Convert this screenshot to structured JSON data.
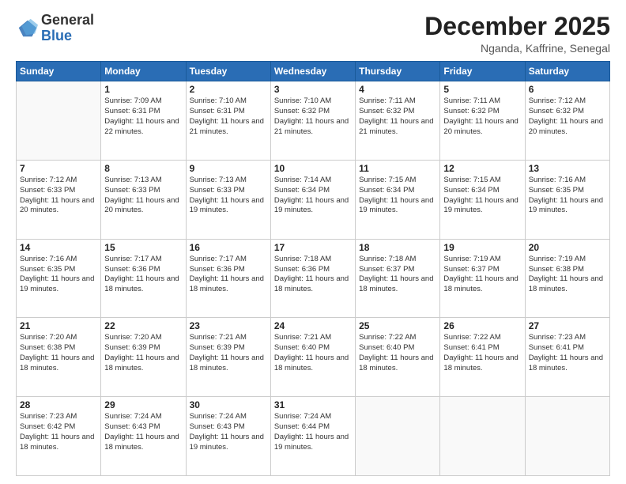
{
  "logo": {
    "general": "General",
    "blue": "Blue"
  },
  "header": {
    "month": "December 2025",
    "location": "Nganda, Kaffrine, Senegal"
  },
  "weekdays": [
    "Sunday",
    "Monday",
    "Tuesday",
    "Wednesday",
    "Thursday",
    "Friday",
    "Saturday"
  ],
  "weeks": [
    [
      {
        "day": "",
        "sunrise": "",
        "sunset": "",
        "daylight": ""
      },
      {
        "day": "1",
        "sunrise": "7:09 AM",
        "sunset": "6:31 PM",
        "daylight": "11 hours and 22 minutes."
      },
      {
        "day": "2",
        "sunrise": "7:10 AM",
        "sunset": "6:31 PM",
        "daylight": "11 hours and 21 minutes."
      },
      {
        "day": "3",
        "sunrise": "7:10 AM",
        "sunset": "6:32 PM",
        "daylight": "11 hours and 21 minutes."
      },
      {
        "day": "4",
        "sunrise": "7:11 AM",
        "sunset": "6:32 PM",
        "daylight": "11 hours and 21 minutes."
      },
      {
        "day": "5",
        "sunrise": "7:11 AM",
        "sunset": "6:32 PM",
        "daylight": "11 hours and 20 minutes."
      },
      {
        "day": "6",
        "sunrise": "7:12 AM",
        "sunset": "6:32 PM",
        "daylight": "11 hours and 20 minutes."
      }
    ],
    [
      {
        "day": "7",
        "sunrise": "7:12 AM",
        "sunset": "6:33 PM",
        "daylight": "11 hours and 20 minutes."
      },
      {
        "day": "8",
        "sunrise": "7:13 AM",
        "sunset": "6:33 PM",
        "daylight": "11 hours and 20 minutes."
      },
      {
        "day": "9",
        "sunrise": "7:13 AM",
        "sunset": "6:33 PM",
        "daylight": "11 hours and 19 minutes."
      },
      {
        "day": "10",
        "sunrise": "7:14 AM",
        "sunset": "6:34 PM",
        "daylight": "11 hours and 19 minutes."
      },
      {
        "day": "11",
        "sunrise": "7:15 AM",
        "sunset": "6:34 PM",
        "daylight": "11 hours and 19 minutes."
      },
      {
        "day": "12",
        "sunrise": "7:15 AM",
        "sunset": "6:34 PM",
        "daylight": "11 hours and 19 minutes."
      },
      {
        "day": "13",
        "sunrise": "7:16 AM",
        "sunset": "6:35 PM",
        "daylight": "11 hours and 19 minutes."
      }
    ],
    [
      {
        "day": "14",
        "sunrise": "7:16 AM",
        "sunset": "6:35 PM",
        "daylight": "11 hours and 19 minutes."
      },
      {
        "day": "15",
        "sunrise": "7:17 AM",
        "sunset": "6:36 PM",
        "daylight": "11 hours and 18 minutes."
      },
      {
        "day": "16",
        "sunrise": "7:17 AM",
        "sunset": "6:36 PM",
        "daylight": "11 hours and 18 minutes."
      },
      {
        "day": "17",
        "sunrise": "7:18 AM",
        "sunset": "6:36 PM",
        "daylight": "11 hours and 18 minutes."
      },
      {
        "day": "18",
        "sunrise": "7:18 AM",
        "sunset": "6:37 PM",
        "daylight": "11 hours and 18 minutes."
      },
      {
        "day": "19",
        "sunrise": "7:19 AM",
        "sunset": "6:37 PM",
        "daylight": "11 hours and 18 minutes."
      },
      {
        "day": "20",
        "sunrise": "7:19 AM",
        "sunset": "6:38 PM",
        "daylight": "11 hours and 18 minutes."
      }
    ],
    [
      {
        "day": "21",
        "sunrise": "7:20 AM",
        "sunset": "6:38 PM",
        "daylight": "11 hours and 18 minutes."
      },
      {
        "day": "22",
        "sunrise": "7:20 AM",
        "sunset": "6:39 PM",
        "daylight": "11 hours and 18 minutes."
      },
      {
        "day": "23",
        "sunrise": "7:21 AM",
        "sunset": "6:39 PM",
        "daylight": "11 hours and 18 minutes."
      },
      {
        "day": "24",
        "sunrise": "7:21 AM",
        "sunset": "6:40 PM",
        "daylight": "11 hours and 18 minutes."
      },
      {
        "day": "25",
        "sunrise": "7:22 AM",
        "sunset": "6:40 PM",
        "daylight": "11 hours and 18 minutes."
      },
      {
        "day": "26",
        "sunrise": "7:22 AM",
        "sunset": "6:41 PM",
        "daylight": "11 hours and 18 minutes."
      },
      {
        "day": "27",
        "sunrise": "7:23 AM",
        "sunset": "6:41 PM",
        "daylight": "11 hours and 18 minutes."
      }
    ],
    [
      {
        "day": "28",
        "sunrise": "7:23 AM",
        "sunset": "6:42 PM",
        "daylight": "11 hours and 18 minutes."
      },
      {
        "day": "29",
        "sunrise": "7:24 AM",
        "sunset": "6:43 PM",
        "daylight": "11 hours and 18 minutes."
      },
      {
        "day": "30",
        "sunrise": "7:24 AM",
        "sunset": "6:43 PM",
        "daylight": "11 hours and 19 minutes."
      },
      {
        "day": "31",
        "sunrise": "7:24 AM",
        "sunset": "6:44 PM",
        "daylight": "11 hours and 19 minutes."
      },
      {
        "day": "",
        "sunrise": "",
        "sunset": "",
        "daylight": ""
      },
      {
        "day": "",
        "sunrise": "",
        "sunset": "",
        "daylight": ""
      },
      {
        "day": "",
        "sunrise": "",
        "sunset": "",
        "daylight": ""
      }
    ]
  ]
}
